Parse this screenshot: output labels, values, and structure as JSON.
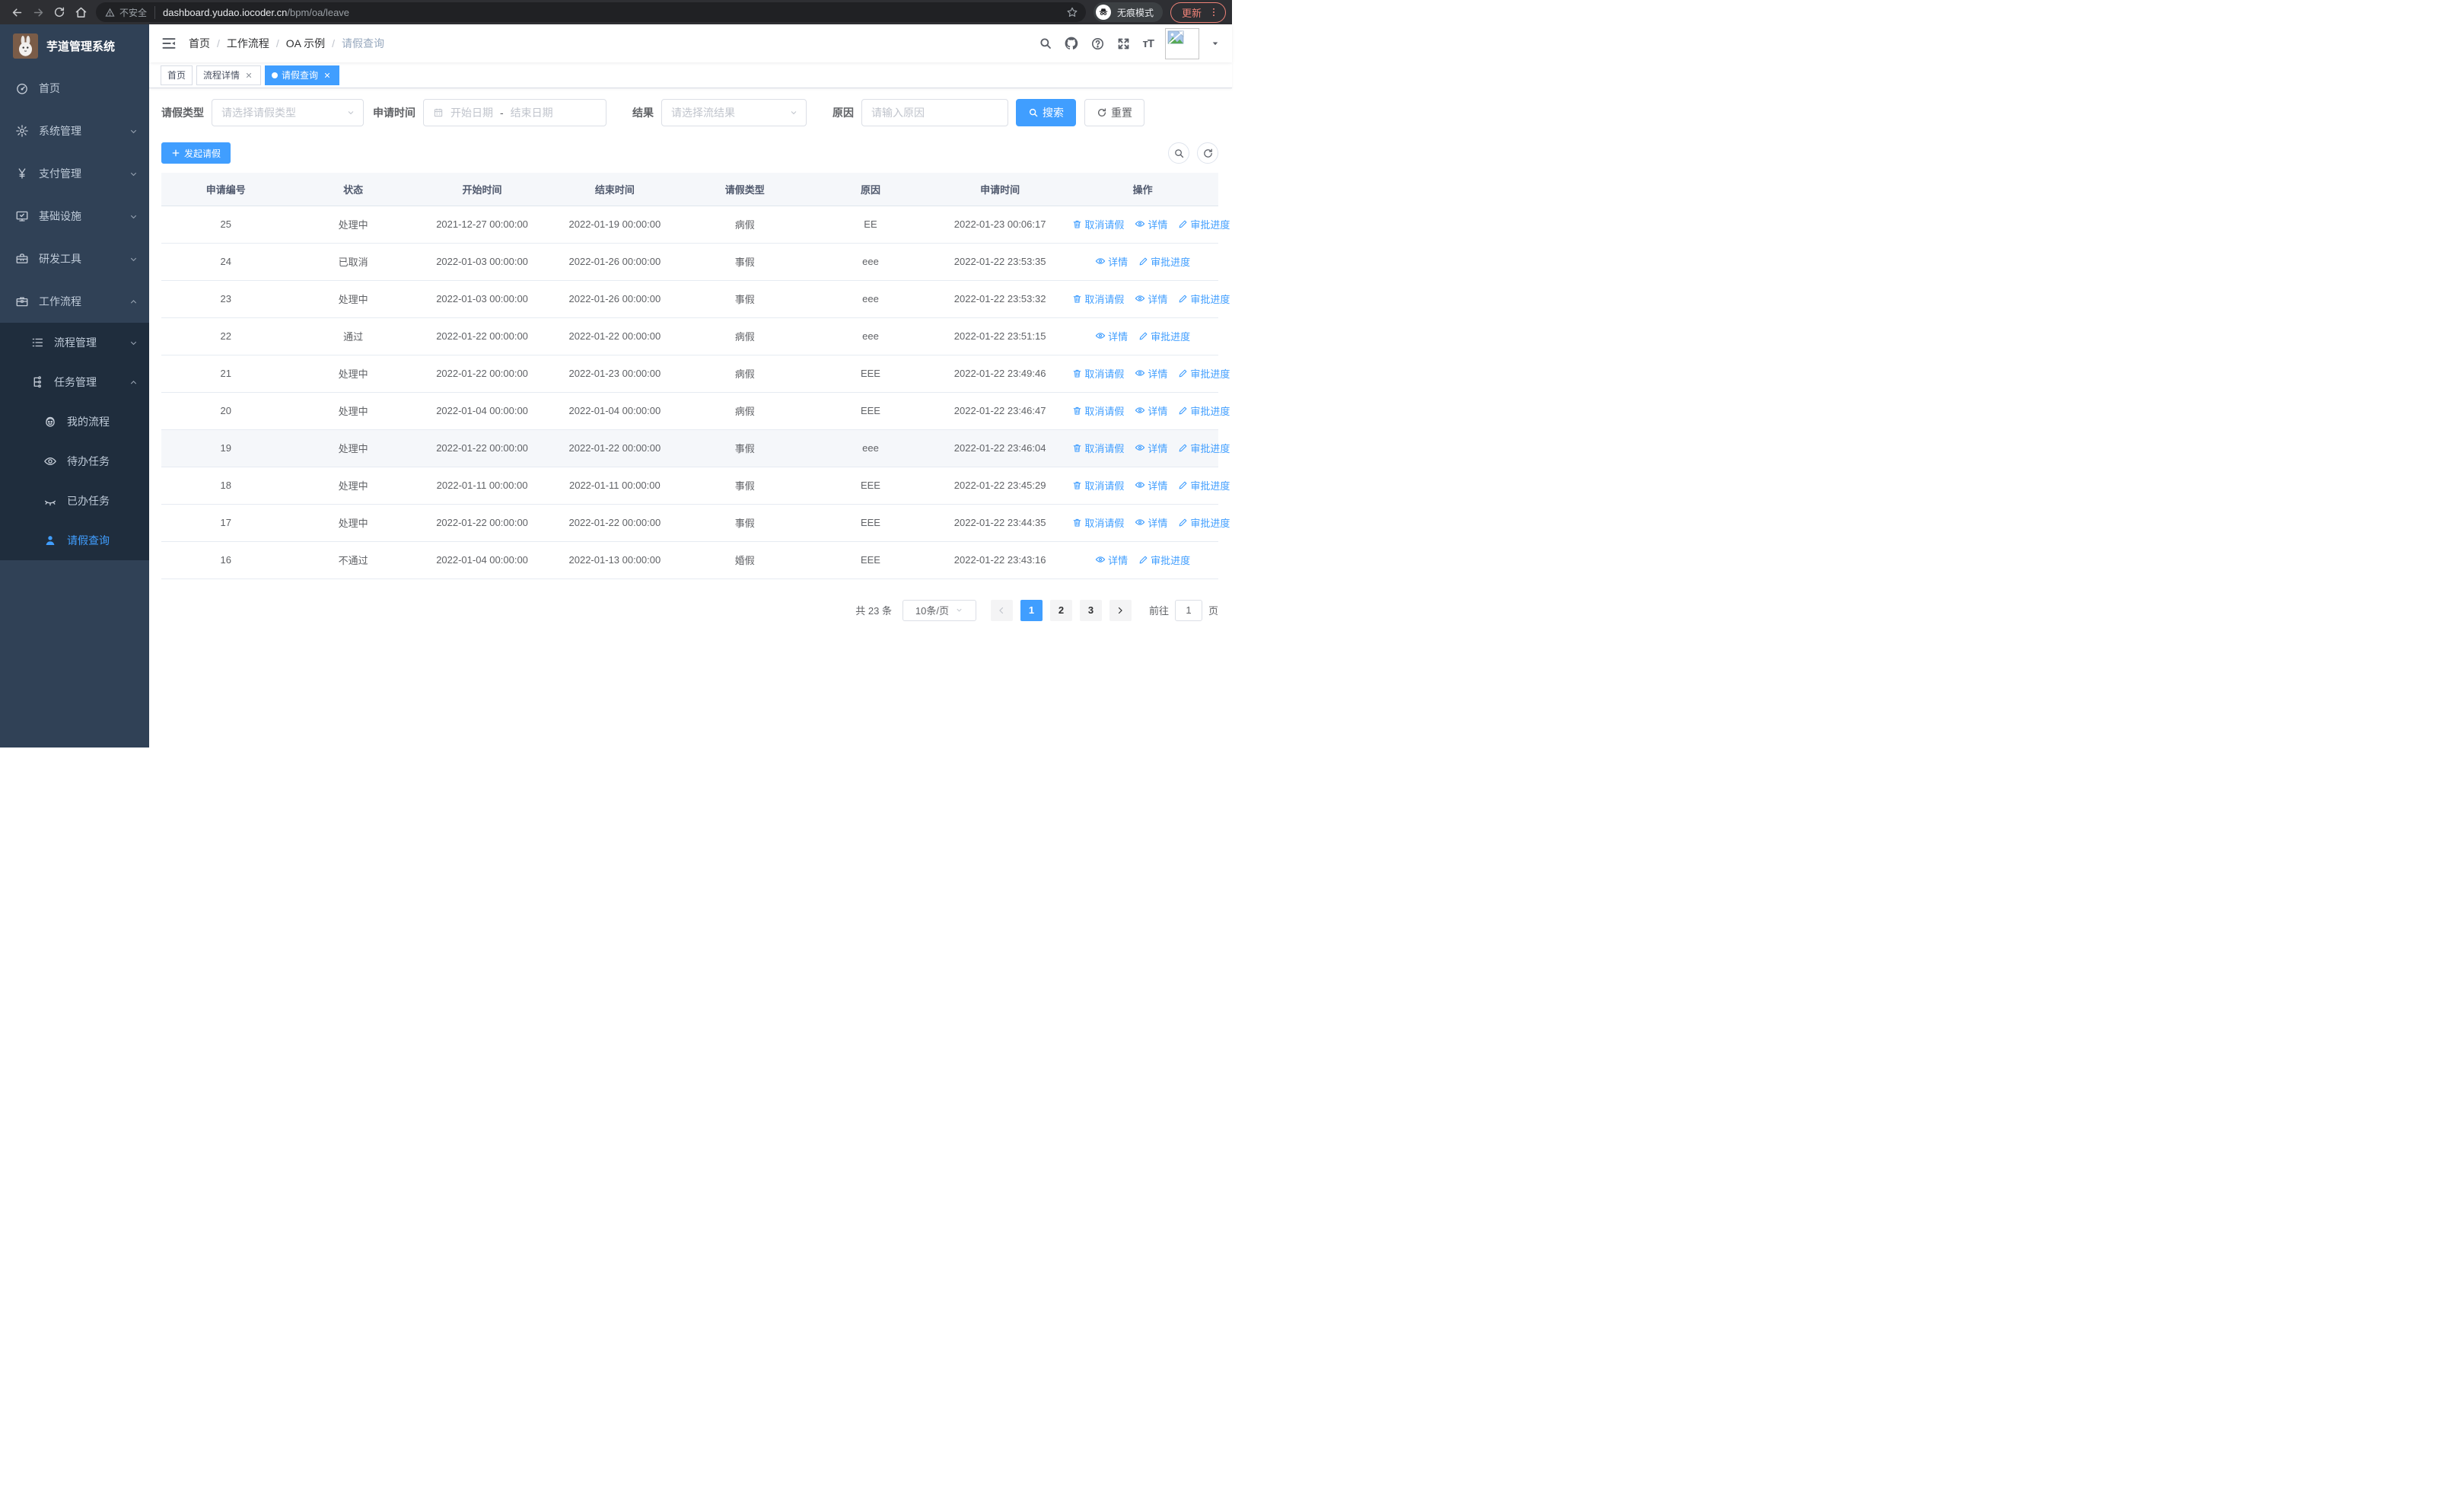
{
  "browser": {
    "security_label": "不安全",
    "url_host": "dashboard.yudao.iocoder.cn",
    "url_path": "/bpm/oa/leave",
    "incognito_label": "无痕模式",
    "update_label": "更新"
  },
  "sidebar": {
    "logo_title": "芋道管理系统",
    "items": [
      {
        "label": "首页",
        "icon": "dashboard-icon",
        "chevron": null
      },
      {
        "label": "系统管理",
        "icon": "gear-icon",
        "chevron": "down"
      },
      {
        "label": "支付管理",
        "icon": "yen-icon",
        "chevron": "down"
      },
      {
        "label": "基础设施",
        "icon": "monitor-icon",
        "chevron": "down"
      },
      {
        "label": "研发工具",
        "icon": "toolbox-icon",
        "chevron": "down"
      },
      {
        "label": "工作流程",
        "icon": "briefcase-icon",
        "chevron": "up"
      }
    ],
    "workflow_children": [
      {
        "label": "流程管理",
        "icon": "list-icon",
        "chevron": "down",
        "level": 2,
        "active": false
      },
      {
        "label": "任务管理",
        "icon": "tree-icon",
        "chevron": "up",
        "level": 2,
        "active": false
      },
      {
        "label": "我的流程",
        "icon": "robot-icon",
        "chevron": null,
        "level": 3,
        "active": false
      },
      {
        "label": "待办任务",
        "icon": "eye-icon",
        "chevron": null,
        "level": 3,
        "active": false
      },
      {
        "label": "已办任务",
        "icon": "eye-closed-icon",
        "chevron": null,
        "level": 3,
        "active": false
      },
      {
        "label": "请假查询",
        "icon": "user-icon",
        "chevron": null,
        "level": 3,
        "active": true
      }
    ]
  },
  "navbar": {
    "breadcrumb": [
      "首页",
      "工作流程",
      "OA 示例",
      "请假查询"
    ]
  },
  "tabs": [
    {
      "label": "首页",
      "closable": false,
      "active": false
    },
    {
      "label": "流程详情",
      "closable": true,
      "active": false
    },
    {
      "label": "请假查询",
      "closable": true,
      "active": true
    }
  ],
  "filters": {
    "leave_type_label": "请假类型",
    "leave_type_placeholder": "请选择请假类型",
    "apply_time_label": "申请时间",
    "date_start_placeholder": "开始日期",
    "date_separator": "-",
    "date_end_placeholder": "结束日期",
    "result_label": "结果",
    "result_placeholder": "请选择流结果",
    "reason_label": "原因",
    "reason_placeholder": "请输入原因",
    "search_label": "搜索",
    "reset_label": "重置"
  },
  "toolbar": {
    "create_label": "发起请假"
  },
  "table": {
    "columns": [
      "申请编号",
      "状态",
      "开始时间",
      "结束时间",
      "请假类型",
      "原因",
      "申请时间",
      "操作"
    ],
    "action_labels": {
      "cancel": "取消请假",
      "detail": "详情",
      "progress": "审批进度"
    },
    "rows": [
      {
        "id": "25",
        "status": "处理中",
        "start": "2021-12-27 00:00:00",
        "end": "2022-01-19 00:00:00",
        "type": "病假",
        "reason": "EE",
        "apply_time": "2022-01-23 00:06:17",
        "actions": [
          "cancel",
          "detail",
          "progress"
        ],
        "highlight": false
      },
      {
        "id": "24",
        "status": "已取消",
        "start": "2022-01-03 00:00:00",
        "end": "2022-01-26 00:00:00",
        "type": "事假",
        "reason": "eee",
        "apply_time": "2022-01-22 23:53:35",
        "actions": [
          "detail",
          "progress"
        ],
        "highlight": false
      },
      {
        "id": "23",
        "status": "处理中",
        "start": "2022-01-03 00:00:00",
        "end": "2022-01-26 00:00:00",
        "type": "事假",
        "reason": "eee",
        "apply_time": "2022-01-22 23:53:32",
        "actions": [
          "cancel",
          "detail",
          "progress"
        ],
        "highlight": false
      },
      {
        "id": "22",
        "status": "通过",
        "start": "2022-01-22 00:00:00",
        "end": "2022-01-22 00:00:00",
        "type": "病假",
        "reason": "eee",
        "apply_time": "2022-01-22 23:51:15",
        "actions": [
          "detail",
          "progress"
        ],
        "highlight": false
      },
      {
        "id": "21",
        "status": "处理中",
        "start": "2022-01-22 00:00:00",
        "end": "2022-01-23 00:00:00",
        "type": "病假",
        "reason": "EEE",
        "apply_time": "2022-01-22 23:49:46",
        "actions": [
          "cancel",
          "detail",
          "progress"
        ],
        "highlight": false
      },
      {
        "id": "20",
        "status": "处理中",
        "start": "2022-01-04 00:00:00",
        "end": "2022-01-04 00:00:00",
        "type": "病假",
        "reason": "EEE",
        "apply_time": "2022-01-22 23:46:47",
        "actions": [
          "cancel",
          "detail",
          "progress"
        ],
        "highlight": false
      },
      {
        "id": "19",
        "status": "处理中",
        "start": "2022-01-22 00:00:00",
        "end": "2022-01-22 00:00:00",
        "type": "事假",
        "reason": "eee",
        "apply_time": "2022-01-22 23:46:04",
        "actions": [
          "cancel",
          "detail",
          "progress"
        ],
        "highlight": true
      },
      {
        "id": "18",
        "status": "处理中",
        "start": "2022-01-11 00:00:00",
        "end": "2022-01-11 00:00:00",
        "type": "事假",
        "reason": "EEE",
        "apply_time": "2022-01-22 23:45:29",
        "actions": [
          "cancel",
          "detail",
          "progress"
        ],
        "highlight": false
      },
      {
        "id": "17",
        "status": "处理中",
        "start": "2022-01-22 00:00:00",
        "end": "2022-01-22 00:00:00",
        "type": "事假",
        "reason": "EEE",
        "apply_time": "2022-01-22 23:44:35",
        "actions": [
          "cancel",
          "detail",
          "progress"
        ],
        "highlight": false
      },
      {
        "id": "16",
        "status": "不通过",
        "start": "2022-01-04 00:00:00",
        "end": "2022-01-13 00:00:00",
        "type": "婚假",
        "reason": "EEE",
        "apply_time": "2022-01-22 23:43:16",
        "actions": [
          "detail",
          "progress"
        ],
        "highlight": false
      }
    ]
  },
  "pagination": {
    "total_label": "共 23 条",
    "page_size": "10条/页",
    "pages": [
      "1",
      "2",
      "3"
    ],
    "active_page": "1",
    "goto_label": "前往",
    "goto_value": "1",
    "page_label": "页"
  },
  "colors": {
    "primary": "#409eff",
    "sidebar_bg": "#304156",
    "submenu_bg": "#1f2d3d",
    "update_accent": "#ee8277"
  }
}
